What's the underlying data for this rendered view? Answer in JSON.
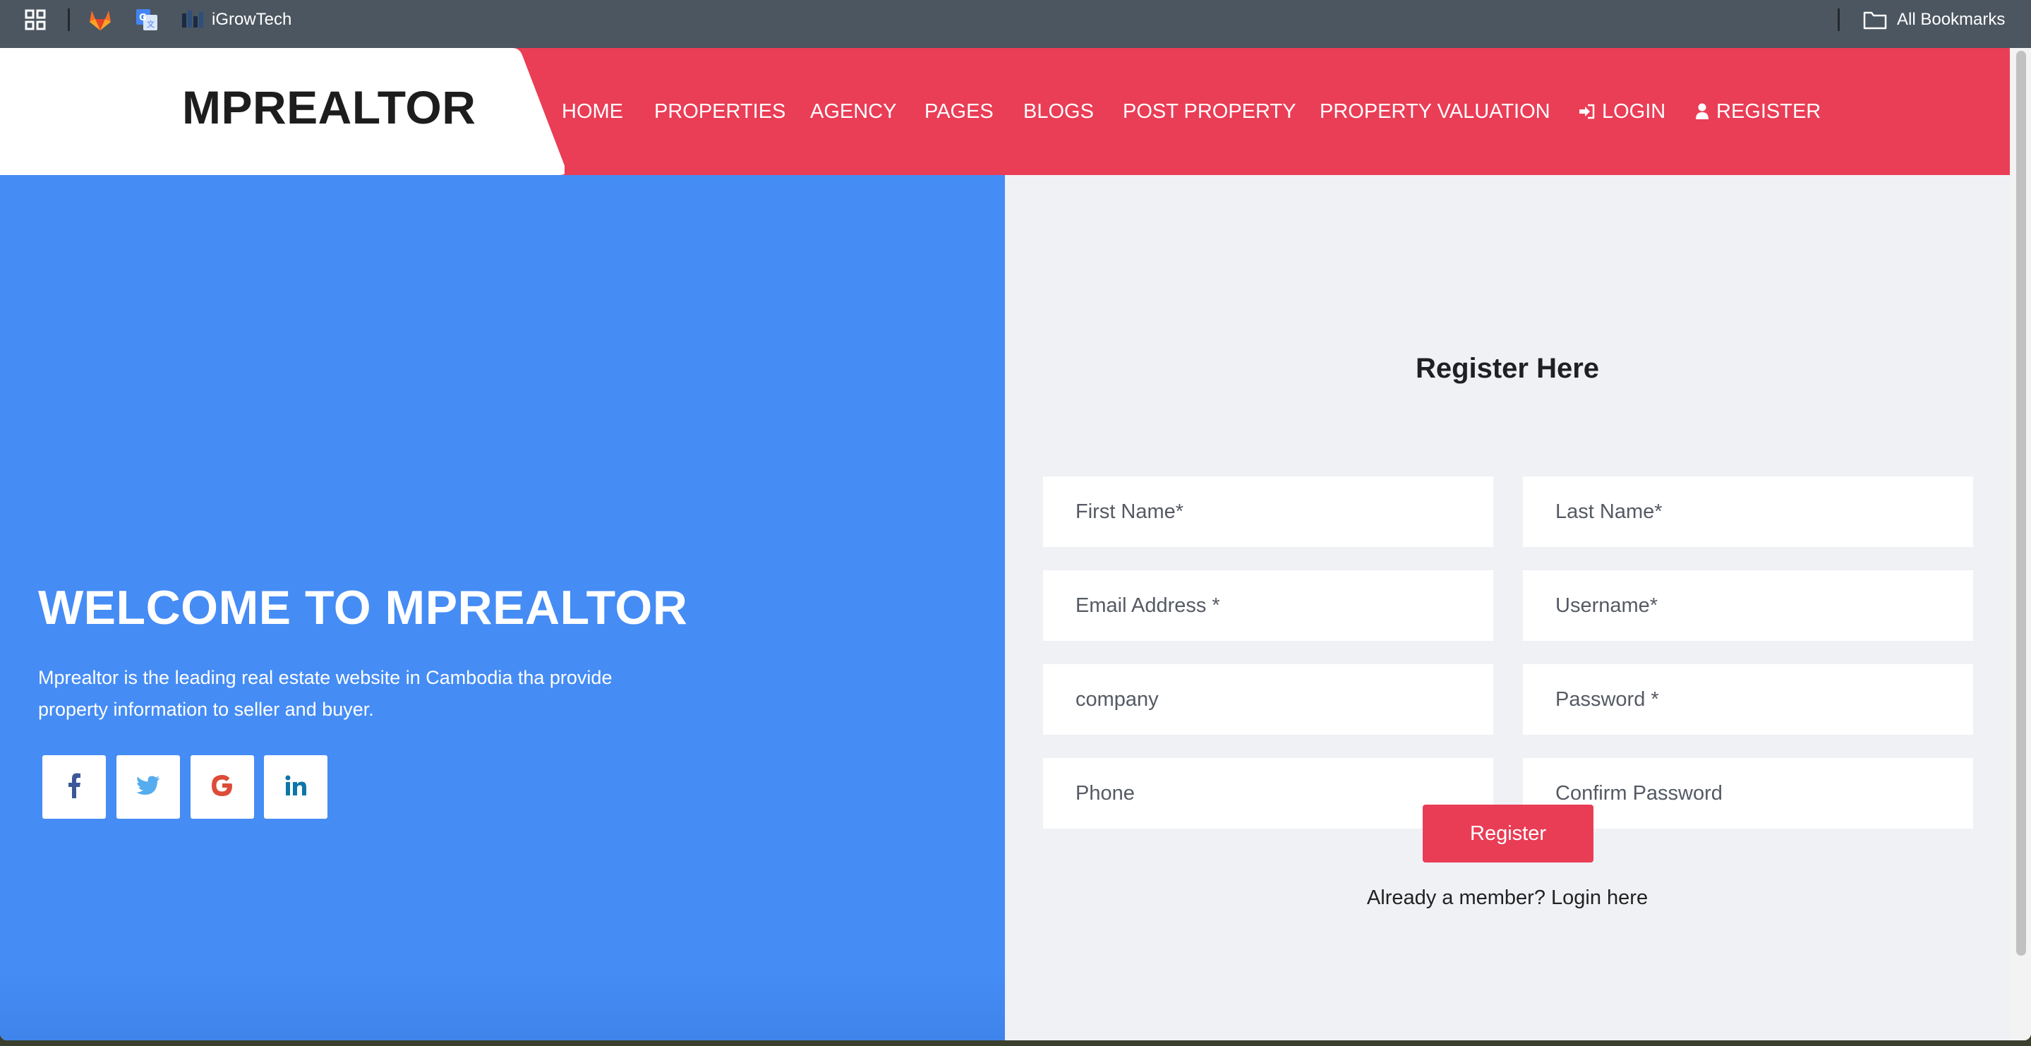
{
  "browser": {
    "bookmarks": [
      {
        "icon": "apps-grid-icon",
        "label": ""
      },
      {
        "icon": "gitlab-icon",
        "label": ""
      },
      {
        "icon": "google-translate-icon",
        "label": ""
      },
      {
        "icon": "igrowtech-favicon-icon",
        "label": "iGrowTech"
      }
    ],
    "all_bookmarks_label": "All Bookmarks"
  },
  "site": {
    "logo": "MPREALTOR",
    "nav": [
      {
        "label": "HOME"
      },
      {
        "label": "PROPERTIES"
      },
      {
        "label": "AGENCY"
      },
      {
        "label": "PAGES"
      },
      {
        "label": "BLOGS"
      },
      {
        "label": "POST PROPERTY"
      },
      {
        "label": "PROPERTY VALUATION"
      },
      {
        "label": "LOGIN",
        "icon": "sign-in-icon"
      },
      {
        "label": "REGISTER",
        "icon": "user-icon"
      }
    ]
  },
  "hero": {
    "title": "WELCOME TO MPREALTOR",
    "description": "Mprealtor is the leading real estate website in Cambodia tha provide property information to seller and buyer.",
    "social": [
      {
        "icon": "facebook-icon",
        "color": "#3b5998"
      },
      {
        "icon": "twitter-icon",
        "color": "#55acee"
      },
      {
        "icon": "google-icon",
        "color": "#dd4b39"
      },
      {
        "icon": "linkedin-icon",
        "color": "#0e76a8"
      }
    ]
  },
  "form": {
    "title": "Register Here",
    "fields": {
      "first_name": {
        "placeholder": "First Name*",
        "value": ""
      },
      "last_name": {
        "placeholder": "Last Name*",
        "value": ""
      },
      "email": {
        "placeholder": "Email Address *",
        "value": ""
      },
      "username": {
        "placeholder": "Username*",
        "value": ""
      },
      "company": {
        "placeholder": "company",
        "value": ""
      },
      "password": {
        "placeholder": "Password *",
        "value": ""
      },
      "phone": {
        "placeholder": "Phone",
        "value": ""
      },
      "confirm_password": {
        "placeholder": "Confirm Password",
        "value": ""
      }
    },
    "submit_label": "Register",
    "login_prompt": "Already a member?",
    "login_link": "Login here"
  },
  "colors": {
    "header_bg": "#ea3d56",
    "hero_bg": "#458cf5",
    "form_bg": "#f0f1f5",
    "button_bg": "#e93d56",
    "bookmarks_bar_bg": "#4b5660"
  }
}
